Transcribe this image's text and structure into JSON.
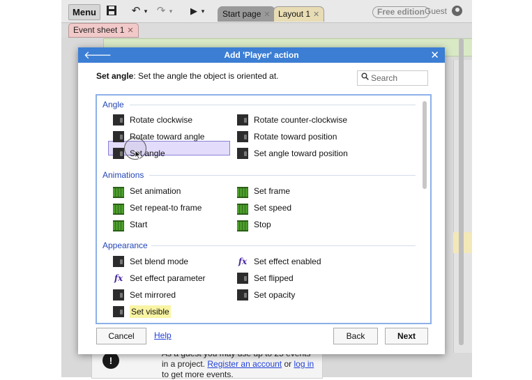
{
  "toolbar": {
    "menu_label": "Menu",
    "tabs": [
      {
        "label": "Start page"
      },
      {
        "label": "Layout 1"
      }
    ],
    "free_badge": "Free edition",
    "user_label": "Guest"
  },
  "event_sheet_tab": {
    "label": "Event sheet 1"
  },
  "dialog": {
    "title": "Add 'Player' action",
    "desc_name": "Set angle",
    "desc_text": ": Set the angle the object is oriented at.",
    "search_placeholder": "Search",
    "groups": {
      "angle": "Angle",
      "animations": "Animations",
      "appearance": "Appearance"
    },
    "items": {
      "rotate_clockwise": "Rotate clockwise",
      "rotate_counter_clockwise": "Rotate counter-clockwise",
      "rotate_toward_angle": "Rotate toward angle",
      "rotate_toward_position": "Rotate toward position",
      "set_angle": "Set angle",
      "set_angle_toward_position": "Set angle toward position",
      "set_animation": "Set animation",
      "set_frame": "Set frame",
      "set_repeat_to_frame": "Set repeat-to frame",
      "set_speed": "Set speed",
      "start": "Start",
      "stop": "Stop",
      "set_blend_mode": "Set blend mode",
      "set_effect_enabled": "Set effect enabled",
      "set_effect_parameter": "Set effect parameter",
      "set_flipped": "Set flipped",
      "set_mirrored": "Set mirrored",
      "set_opacity": "Set opacity",
      "set_visible": "Set visible"
    },
    "buttons": {
      "cancel": "Cancel",
      "help": "Help",
      "back": "Back",
      "next": "Next"
    }
  },
  "guest_note": {
    "text1": "As a guest you may use up to 25 events in a project.",
    "link1": "Register an account",
    "or": "or",
    "link2": "log in",
    "text2": "to get more events."
  },
  "icons": {
    "back": "arrow-left-icon",
    "close": "close-icon",
    "search": "search-icon",
    "fx": "fx-icon"
  },
  "colors": {
    "header": "#3b7ed4",
    "group_text": "#2346b8",
    "selection": "#e3dcfa",
    "highlight": "#f9f4a3"
  }
}
